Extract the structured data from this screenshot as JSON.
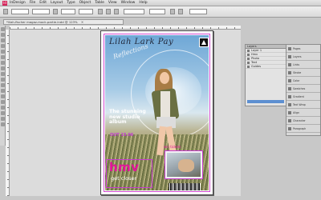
{
  "menubar": {
    "app_logo": "Id",
    "items": [
      "InDesign",
      "File",
      "Edit",
      "Layout",
      "Type",
      "Object",
      "Table",
      "View",
      "Window",
      "Help"
    ]
  },
  "document_tab": {
    "title": "*lilah-fischer magaz-mock-partie.indd @ 123%"
  },
  "cover": {
    "masthead": "Lilah Lark Pay",
    "subhead": "Reflections",
    "cover_line": "The stunning new studio album",
    "cover_date": "OUT 15.06",
    "brand": "hmv",
    "tagline": "get closer",
    "inset_label": "win tickets"
  },
  "layers_panel": {
    "title": "Layers",
    "rows": [
      "Layer 1",
      "Hmv",
      "Photo",
      "Text",
      "Guides"
    ]
  },
  "dock": {
    "items": [
      "Pages",
      "Layers",
      "Links",
      "Stroke",
      "Color",
      "Swatches",
      "Gradient",
      "Text Wrap",
      "Align",
      "Character",
      "Paragraph"
    ]
  },
  "colors": {
    "accent_magenta": "#e3129a",
    "frame_purple": "#c73bd0"
  }
}
